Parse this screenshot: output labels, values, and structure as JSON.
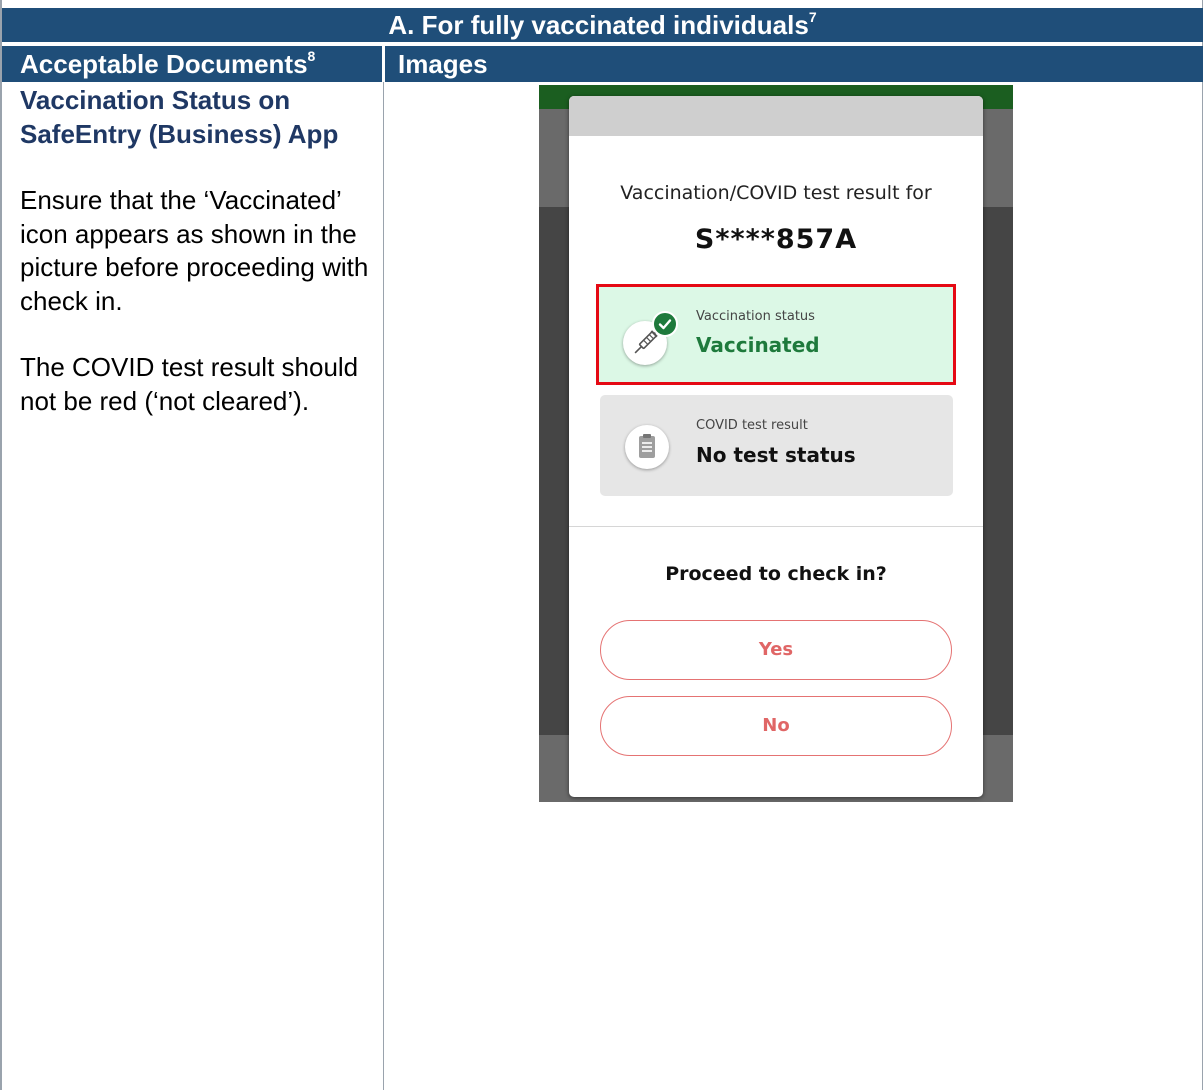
{
  "table": {
    "title": "A.  For fully vaccinated individuals",
    "title_footnote": "7",
    "col1_header": "Acceptable Documents",
    "col1_footnote": "8",
    "col2_header": "Images"
  },
  "left": {
    "heading": "Vaccination Status on SafeEntry (Business) App",
    "para1": "Ensure that the ‘Vaccinated’ icon appears as shown in the picture before proceeding with check in.",
    "para2": "The COVID test result should not be red (‘not cleared’)."
  },
  "dialog": {
    "for_label": "Vaccination/COVID test result for",
    "masked_id": "S****857A",
    "vaccination": {
      "label": "Vaccination status",
      "value": "Vaccinated",
      "icon": "syringe-icon",
      "badge_icon": "check-icon",
      "color": "#1e7a3c",
      "highlight": "#e50914"
    },
    "covid_test": {
      "label": "COVID test result",
      "value": "No test status",
      "icon": "clipboard-icon"
    },
    "question": "Proceed to check in?",
    "yes_label": "Yes",
    "no_label": "No",
    "accent": "#e06666"
  }
}
